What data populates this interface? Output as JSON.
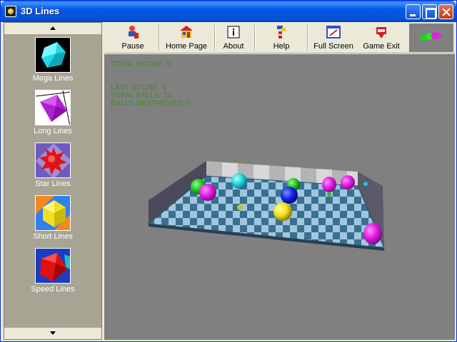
{
  "window": {
    "title": "3D Lines"
  },
  "sidebar": {
    "items": [
      {
        "label": "Mega Lines",
        "icon": "cyan-cube-icon",
        "color": "#2ee6e6",
        "bg": "#000000"
      },
      {
        "label": "Long Lines",
        "icon": "purple-cube-icon",
        "color": "#b01fd4",
        "bg": "#ffffff"
      },
      {
        "label": "Star Lines",
        "icon": "red-star-icon",
        "color": "#e01010",
        "bg": "#7060c0"
      },
      {
        "label": "Short Lines",
        "icon": "yellow-cube-icon",
        "color": "#f0e020",
        "bg": "#f08a20"
      },
      {
        "label": "Speed Lines",
        "icon": "red-cube-icon",
        "color": "#e01010",
        "bg": "#2040c0"
      }
    ]
  },
  "toolbar": {
    "items": [
      {
        "label": "Pause",
        "icon": "pause-icon"
      },
      {
        "label": "Home Page",
        "icon": "home-icon"
      },
      {
        "label": "About",
        "icon": "about-icon"
      },
      {
        "label": "Help",
        "icon": "help-icon"
      },
      {
        "label": "Full Screen",
        "icon": "fullscreen-icon"
      },
      {
        "label": "Game Exit",
        "icon": "exit-icon"
      }
    ],
    "logo_icon": "balls-logo-icon"
  },
  "game": {
    "background": "#808080",
    "stats_color": "#3c8e1c",
    "stats": {
      "total_score": "TOTAL SCORE: 0",
      "last_score": "LAST SCORE: 0",
      "total_balls": "TOTAL BALLS: 11",
      "balls_destroyed": "BALLS DESTROYED: 0"
    }
  }
}
